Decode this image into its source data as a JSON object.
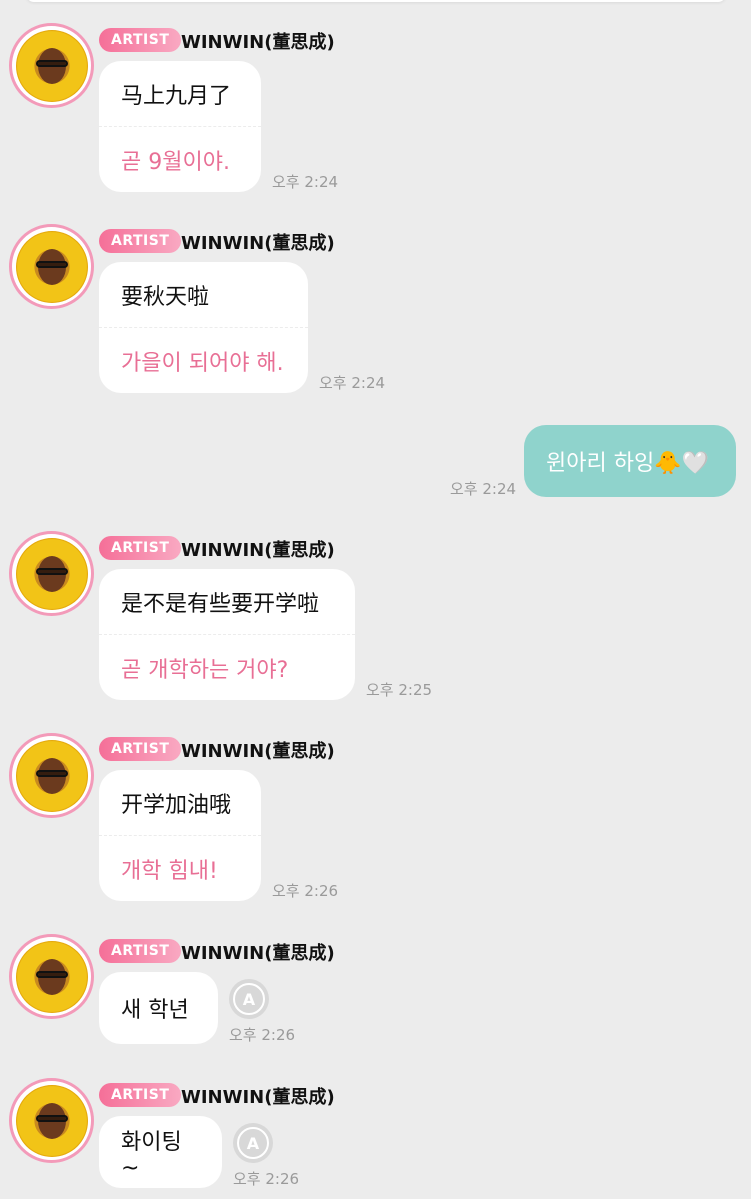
{
  "badge_label": "ARTIST",
  "messages": [
    {
      "name": "WINWIN(董思成)",
      "original": "马上九月了",
      "translation": "곧 9월이야.",
      "time": "오후 2:24"
    },
    {
      "name": "WINWIN(董思成)",
      "original": "要秋天啦",
      "translation": "가을이 되어야 해.",
      "time": "오후 2:24"
    },
    {
      "mine": true,
      "text": "윈아리 하잉🐥🤍",
      "time": "오후 2:24"
    },
    {
      "name": "WINWIN(董思成)",
      "original": "是不是有些要开学啦",
      "translation": "곧 개학하는 거야?",
      "time": "오후 2:25"
    },
    {
      "name": "WINWIN(董思成)",
      "original": "开学加油哦",
      "translation": "개학 힘내!",
      "time": "오후 2:26"
    },
    {
      "name": "WINWIN(董思成)",
      "original": "새 학년",
      "time": "오후 2:26",
      "translate_icon": "translate-icon"
    },
    {
      "name": "WINWIN(董思成)",
      "original": "화이팅~",
      "time": "오후 2:26",
      "translate_icon": "translate-icon"
    }
  ],
  "colors": {
    "background": "#ececec",
    "badge_start": "#f56f98",
    "translation_text": "#e86f95",
    "my_bubble": "#8fd3cc",
    "avatar_ring": "#f39ab9"
  }
}
